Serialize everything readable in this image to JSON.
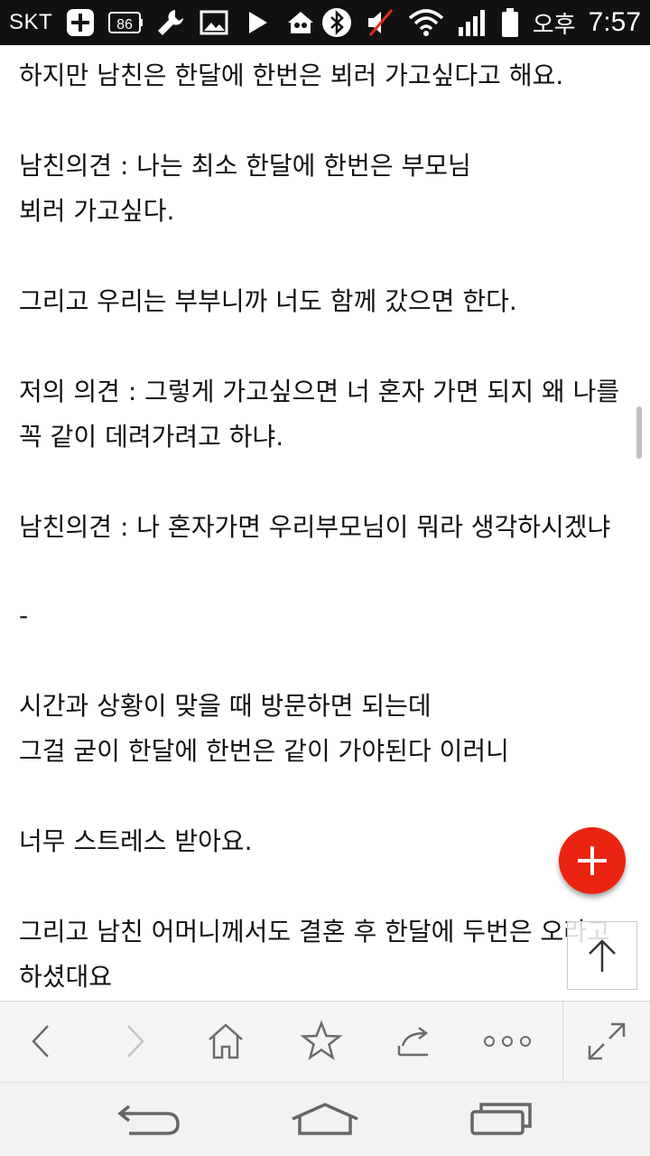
{
  "status_bar": {
    "carrier": "SKT",
    "battery_level": "86",
    "ampm": "오후",
    "time": "7:57",
    "icons": [
      "plus-box-icon",
      "battery-86-icon",
      "wrench-icon",
      "image-icon",
      "play-icon",
      "home-cam-icon",
      "bluetooth-icon",
      "mute-icon",
      "wifi-icon",
      "signal-icon",
      "battery-icon"
    ]
  },
  "content": {
    "lines": [
      "하지만 남친은 한달에 한번은 뵈러 가고싶다고 해요.",
      "남친의견 : 나는 최소 한달에 한번은 부모님",
      "뵈러 가고싶다.",
      "그리고 우리는 부부니까 너도 함께 갔으면 한다.",
      "저의 의견 : 그렇게 가고싶으면 너 혼자 가면 되지 왜 나를",
      "꼭 같이 데려가려고 하냐.",
      "남친의견 : 나 혼자가면 우리부모님이 뭐라 생각하시겠냐",
      "-",
      "시간과 상황이 맞을 때 방문하면 되는데",
      "그걸 굳이 한달에 한번은 같이 가야된다 이러니",
      "너무 스트레스 받아요.",
      "그리고 남친 어머니께서도 결혼 후 한달에 두번은 오라고",
      "하셨대요"
    ]
  },
  "toolbar": {
    "buttons": [
      "back-icon",
      "forward-icon",
      "home-icon",
      "star-icon",
      "share-icon",
      "more-icon",
      "fullscreen-icon"
    ]
  },
  "navbar": {
    "buttons": [
      "back-arrow-icon",
      "home-icon",
      "recent-apps-icon"
    ]
  },
  "colors": {
    "fab": "#ea2410",
    "statusbar": "#111111",
    "toolbar": "#f4f4f4"
  }
}
